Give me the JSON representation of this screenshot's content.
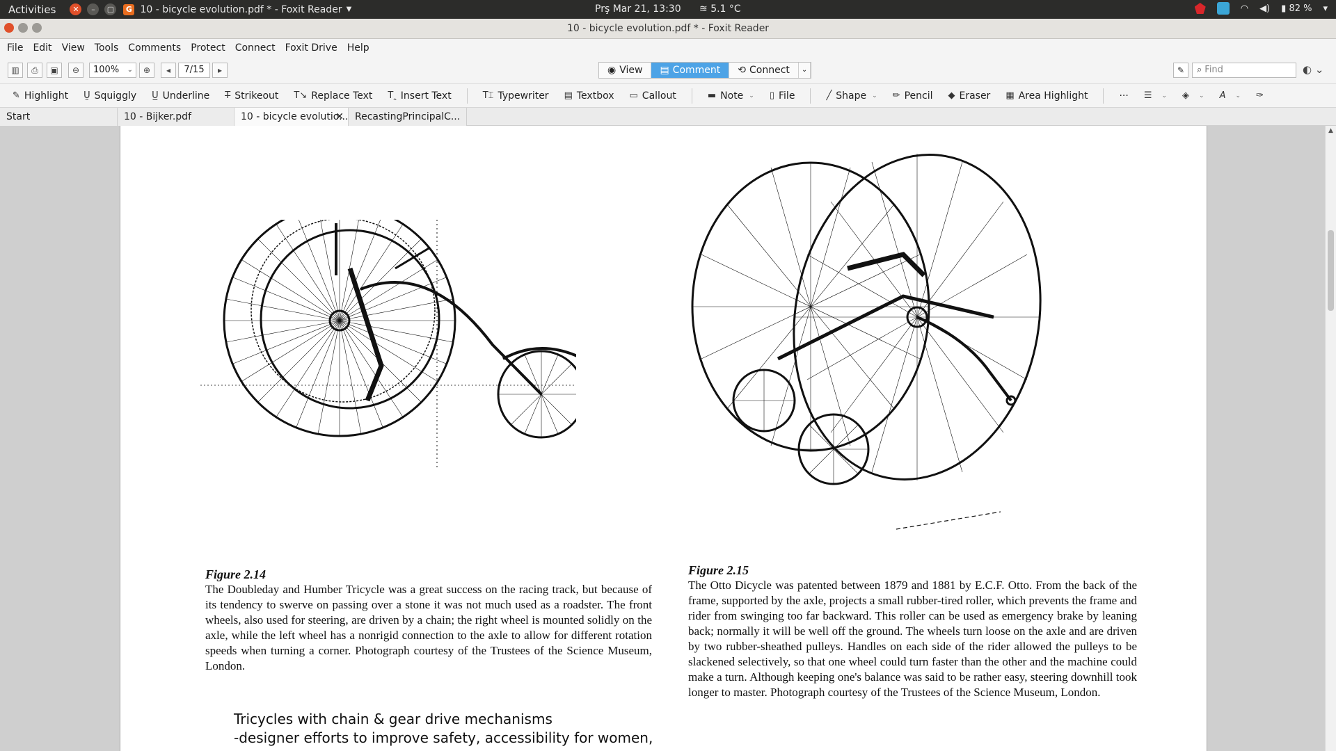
{
  "topbar": {
    "activities": "Activities",
    "app_title": "10 - bicycle evolution.pdf * - Foxit Reader",
    "app_logo": "G",
    "clock": "Prş Mar 21, 13:30",
    "weather": "5.1 °C",
    "battery": "82 %"
  },
  "window": {
    "title": "10 - bicycle evolution.pdf * - Foxit Reader"
  },
  "menu": [
    "File",
    "Edit",
    "View",
    "Tools",
    "Comments",
    "Connect",
    "Protect",
    "Connect",
    "Foxit Drive",
    "Help"
  ],
  "menu_items": {
    "file": "File",
    "edit": "Edit",
    "view": "View",
    "tools": "Tools",
    "comments": "Comments",
    "protect": "Protect",
    "connect": "Connect",
    "foxit_drive": "Foxit Drive",
    "help": "Help"
  },
  "toolbar": {
    "zoom": "100%",
    "page": "7/15",
    "view_label": "View",
    "comment_label": "Comment",
    "connect_label": "Connect",
    "find_placeholder": "Find"
  },
  "comment_tools": {
    "highlight": "Highlight",
    "squiggly": "Squiggly",
    "underline": "Underline",
    "strikeout": "Strikeout",
    "replace_text": "Replace Text",
    "insert_text": "Insert Text",
    "typewriter": "Typewriter",
    "textbox": "Textbox",
    "callout": "Callout",
    "note": "Note",
    "file": "File",
    "shape": "Shape",
    "pencil": "Pencil",
    "eraser": "Eraser",
    "area_highlight": "Area Highlight",
    "more": "···"
  },
  "tabs": {
    "start": "Start",
    "bijker": "10 - Bijker.pdf",
    "bicycle": "10 - bicycle evolutio...",
    "recasting": "RecastingPrincipalC..."
  },
  "document": {
    "fig14_title": "Figure 2.14",
    "fig14_text": "The Doubleday and Humber Tricycle was a great success on the racing track, but because of its tendency to swerve on passing over a stone it was not much used as a roadster. The front wheels, also used for steering, are driven by a chain; the right wheel is mounted solidly on the axle, while the left wheel has a nonrigid connection to the axle to allow for different rotation speeds when turning a corner. Photograph courtesy of the Trustees of the Science Museum, London.",
    "fig15_title": "Figure 2.15",
    "fig15_text": "The Otto Dicycle was patented between 1879 and 1881 by E.C.F. Otto. From the back of the frame, supported by the axle, projects a small rubber-tired roller, which prevents the frame and rider from swinging too far backward. This roller can be used as emergency brake by leaning back; normally it will be well off the ground. The wheels turn loose on the axle and are driven by two rubber-sheathed pulleys. Handles on each side of the rider allowed the pulleys to be slackened selectively, so that one wheel could turn faster than the other and the machine could make a turn. Although keeping one's balance was said to be rather easy, steering downhill took longer to master. Photograph courtesy of the Trustees of the Science Museum, London.",
    "note_line1": "Tricycles with chain & gear drive mechanisms",
    "note_line2": "-designer efforts to improve safety, accessibility for women,"
  }
}
